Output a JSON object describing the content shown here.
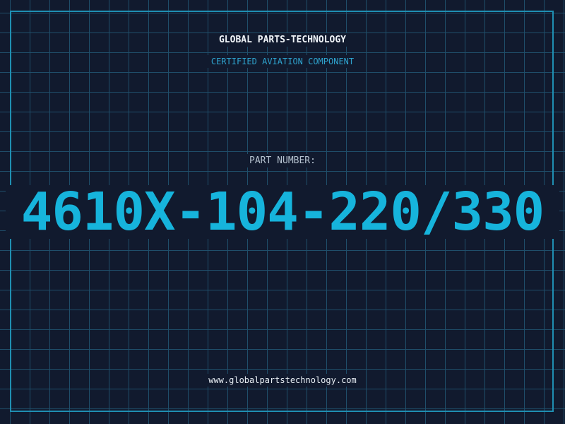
{
  "header": {
    "company": "GLOBAL PARTS-TECHNOLOGY",
    "subtitle": "CERTIFIED AVIATION COMPONENT"
  },
  "part": {
    "label": "PART NUMBER:",
    "number": "4610X-104-220/330"
  },
  "footer": {
    "website": "www.globalpartstechnology.com"
  },
  "colors": {
    "background": "#111a2e",
    "grid": "#1f4e6a",
    "accent": "#16b4dc",
    "frame": "#1f8fb2"
  }
}
